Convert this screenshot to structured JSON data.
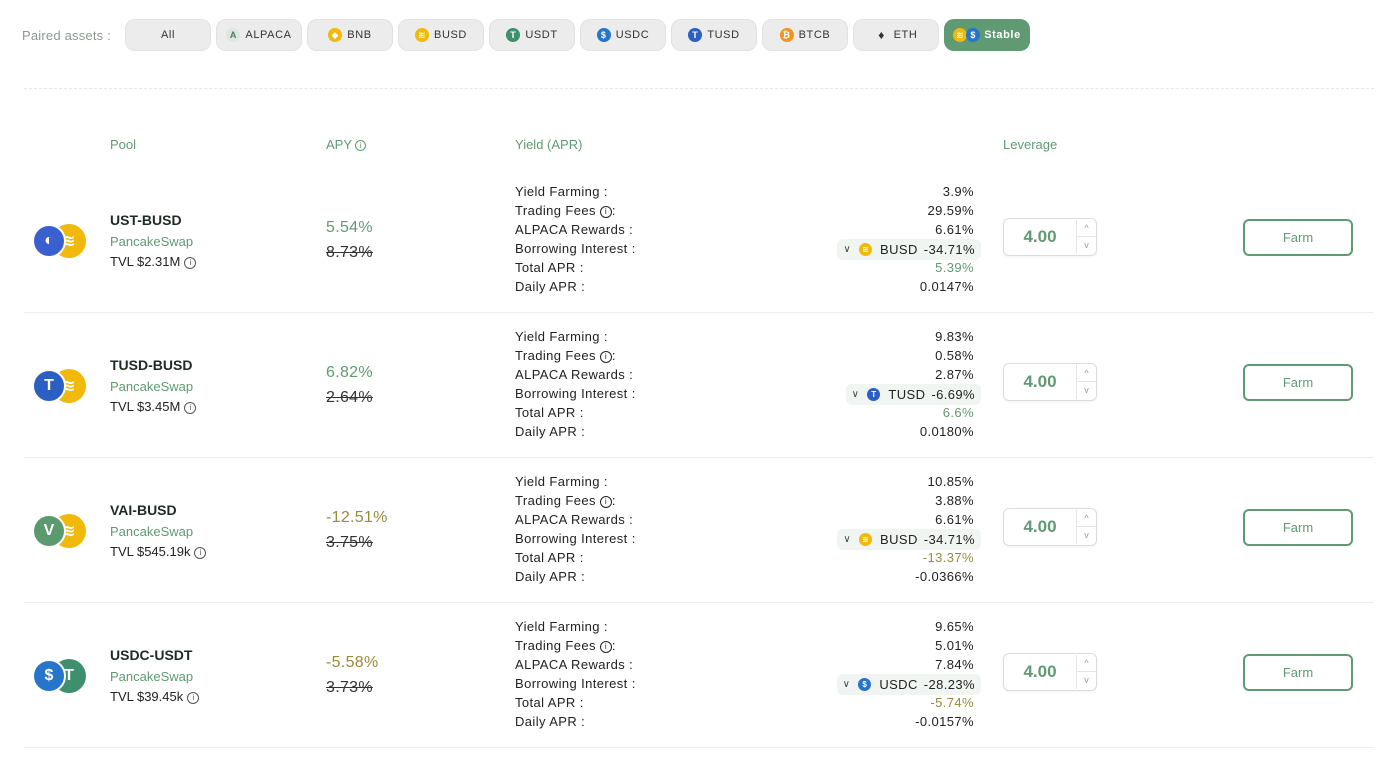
{
  "filter": {
    "label": "Paired assets :",
    "chips": [
      {
        "label": "All",
        "icon": "none",
        "active": false
      },
      {
        "label": "ALPACA",
        "icon": "alpaca-icon",
        "active": false
      },
      {
        "label": "BNB",
        "icon": "bnb-icon",
        "active": false
      },
      {
        "label": "BUSD",
        "icon": "busd-icon",
        "active": false
      },
      {
        "label": "USDT",
        "icon": "usdt-icon",
        "active": false
      },
      {
        "label": "USDC",
        "icon": "usdc-icon",
        "active": false
      },
      {
        "label": "TUSD",
        "icon": "tusd-icon",
        "active": false
      },
      {
        "label": "BTCB",
        "icon": "btcb-icon",
        "active": false
      },
      {
        "label": "ETH",
        "icon": "eth-icon",
        "active": false
      },
      {
        "label": "Stable",
        "icon": "stable-icon",
        "active": true
      }
    ]
  },
  "columns": {
    "pool": "Pool",
    "apy": "APY",
    "yield": "Yield (APR)",
    "leverage": "Leverage"
  },
  "labels": {
    "yield_farming": "Yield Farming :",
    "trading_fees": "Trading Fees",
    "trading_fees_suffix": ":",
    "alpaca_rewards": "ALPACA Rewards :",
    "borrowing_interest": "Borrowing Interest :",
    "total_apr": "Total APR :",
    "daily_apr": "Daily APR :",
    "farm_button": "Farm"
  },
  "colors": {
    "accent": "#5f9a72",
    "negative": "#9a8a3a",
    "busd": "#f0b90b",
    "tusd": "#2b5fc4",
    "usdc": "#2775ca",
    "vai": "#5a9a6e",
    "ust": "#3a5fcf"
  },
  "pools": [
    {
      "name": "UST-BUSD",
      "dex": "PancakeSwap",
      "tvl": "TVL $2.31M",
      "apy": "5.54%",
      "apy_old": "8.73%",
      "apy_sign": "pos",
      "yield_farming": "3.9%",
      "trading_fees": "29.59%",
      "alpaca_rewards": "6.61%",
      "borrow_token": "BUSD",
      "borrow_value": "-34.71%",
      "total_apr": "5.39%",
      "daily_apr": "0.0147%",
      "leverage": "4.00"
    },
    {
      "name": "TUSD-BUSD",
      "dex": "PancakeSwap",
      "tvl": "TVL $3.45M",
      "apy": "6.82%",
      "apy_old": "2.64%",
      "apy_sign": "pos",
      "yield_farming": "9.83%",
      "trading_fees": "0.58%",
      "alpaca_rewards": "2.87%",
      "borrow_token": "TUSD",
      "borrow_value": "-6.69%",
      "total_apr": "6.6%",
      "daily_apr": "0.0180%",
      "leverage": "4.00"
    },
    {
      "name": "VAI-BUSD",
      "dex": "PancakeSwap",
      "tvl": "TVL $545.19k",
      "apy": "-12.51%",
      "apy_old": "3.75%",
      "apy_sign": "neg",
      "yield_farming": "10.85%",
      "trading_fees": "3.88%",
      "alpaca_rewards": "6.61%",
      "borrow_token": "BUSD",
      "borrow_value": "-34.71%",
      "total_apr": "-13.37%",
      "daily_apr": "-0.0366%",
      "leverage": "4.00"
    },
    {
      "name": "USDC-USDT",
      "dex": "PancakeSwap",
      "tvl": "TVL $39.45k",
      "apy": "-5.58%",
      "apy_old": "3.73%",
      "apy_sign": "neg",
      "yield_farming": "9.65%",
      "trading_fees": "5.01%",
      "alpaca_rewards": "7.84%",
      "borrow_token": "USDC",
      "borrow_value": "-28.23%",
      "total_apr": "-5.74%",
      "daily_apr": "-0.0157%",
      "leverage": "4.00"
    }
  ]
}
